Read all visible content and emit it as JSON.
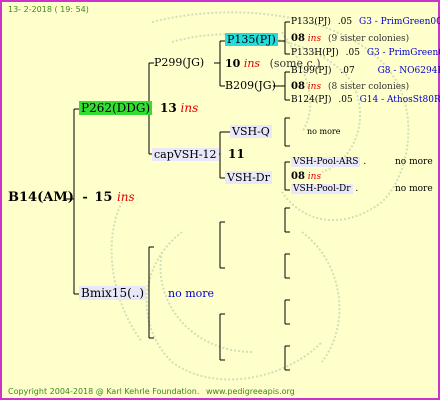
{
  "header": {
    "date": "13- 2-2018 ( 19: 54)"
  },
  "footer": {
    "copyright": "Copyright 2004-2018 @ Karl Kehrle Foundation.",
    "site": "www.pedigreeapis.org"
  },
  "root": {
    "name": "B14(AM)",
    "count": "15",
    "ins": "ins"
  },
  "gen1": {
    "sire": {
      "name": "P262(DDG)",
      "count": "13",
      "ins": "ins"
    },
    "dam": {
      "name": "Bmix15(..)",
      "note": "no more"
    }
  },
  "gen2": {
    "a": {
      "name": "P299(JG)"
    },
    "b": {
      "name": "capVSH-12",
      "count": "11"
    }
  },
  "gen3": {
    "a": {
      "name": "P135(PJ)",
      "count": "10",
      "ins": "ins",
      "note": "(some c.)"
    },
    "b": {
      "name": "B209(JG)"
    },
    "c": {
      "name": "VSH-Q",
      "note": "no more"
    },
    "d": {
      "name": "VSH-Dr"
    }
  },
  "gen4": {
    "a1": {
      "name": "P133(PJ)",
      "year": ".05",
      "origin": "G3 - PrimGreen00"
    },
    "a2": {
      "count": "08",
      "ins": "ins",
      "note": "(9 sister colonies)"
    },
    "a3": {
      "name": "P133H(PJ)",
      "year": ".05",
      "origin": "G3 - PrimGreen00"
    },
    "b1": {
      "name": "B199(PJ)",
      "year": ".07",
      "origin": "G8 - NO6294R"
    },
    "b2": {
      "count": "08",
      "ins": "ins",
      "note": "(8 sister colonies)"
    },
    "b3": {
      "name": "B124(PJ)",
      "year": ".05",
      "origin": "G14 - AthosSt80R"
    },
    "d1": {
      "name": "VSH-Pool-ARS",
      "dot": ".",
      "note": "no more"
    },
    "d2": {
      "count": "08",
      "ins": "ins"
    },
    "d3": {
      "name": "VSH-Pool-Dr",
      "dot": ".",
      "note": "no more"
    }
  },
  "colors": {
    "background": "#ffffcc",
    "border": "#cc33cc",
    "green_box": "#33dd33",
    "cyan_box": "#22dddd",
    "ins": "#e00000",
    "link": "#0000cc",
    "footer": "#3a8a1a"
  }
}
